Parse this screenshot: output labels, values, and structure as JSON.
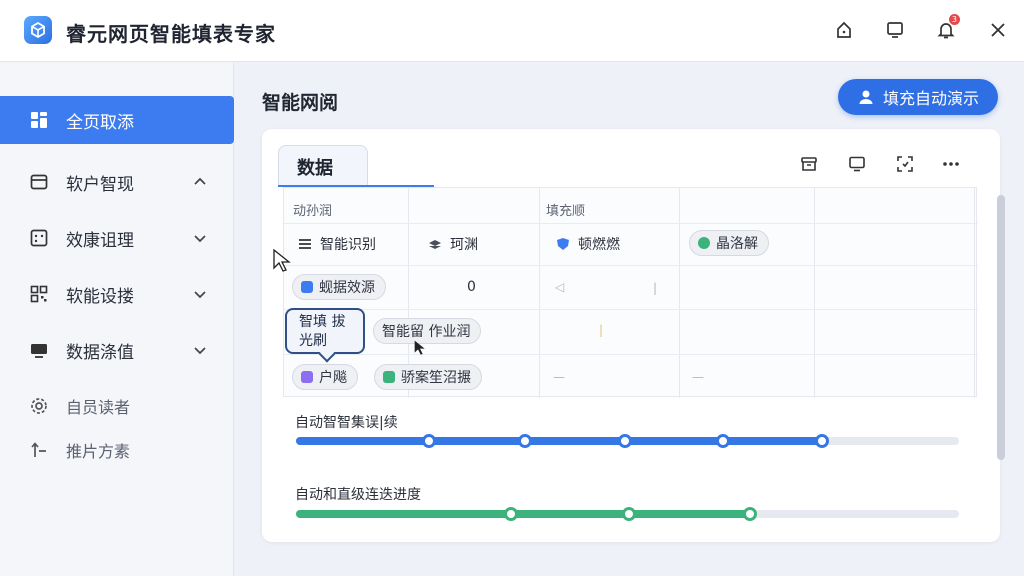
{
  "app": {
    "title": "睿元网页智能填表专家",
    "notification_count": "3"
  },
  "sidebar": {
    "items": [
      {
        "label": "全页取添",
        "icon": "grid-icon",
        "active": true
      },
      {
        "label": "软户智现",
        "icon": "calendar-icon",
        "expanded": true
      },
      {
        "label": "效康诅理",
        "icon": "form-icon"
      },
      {
        "label": "软能设搂",
        "icon": "qr-icon"
      },
      {
        "label": "数据涤值",
        "icon": "monitor-icon"
      }
    ],
    "minor": [
      {
        "label": "自员读者",
        "icon": "gear-icon"
      },
      {
        "label": "推片方素",
        "icon": "upload-icon"
      }
    ]
  },
  "main": {
    "title": "智能网阅",
    "demo_button": "填充自动演示",
    "tab": "数据",
    "table": {
      "headers": [
        "动孙润",
        "填充顺"
      ],
      "row1": {
        "c1": "智能识别",
        "c2": "珂渊",
        "c3": "顿燃燃",
        "c4": "晶洛解"
      },
      "row2": {
        "chip": "蚬据效源",
        "value": "0"
      },
      "row3": {
        "tooltip": "智填 拔光刷",
        "chip": "智能留 作业润"
      },
      "row4": {
        "chip1": "户飚",
        "chip2": "骄案笙沼搌"
      },
      "dash": "—"
    },
    "progress": [
      {
        "label": "自动智智集误|续",
        "value": 0.79,
        "color": "#3578e5"
      },
      {
        "label": "自动和直级连迭进度",
        "value": 0.69,
        "color": "#3cb27c"
      }
    ]
  }
}
